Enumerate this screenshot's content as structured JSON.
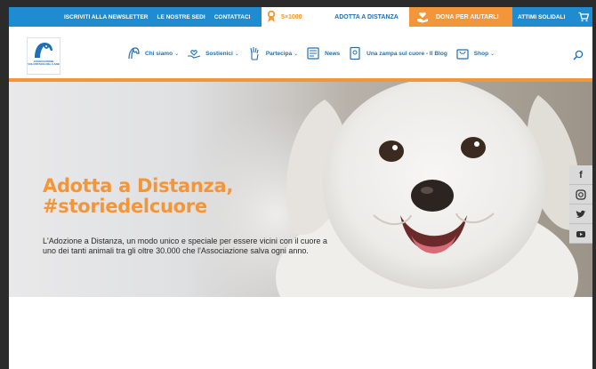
{
  "topbar": {
    "links": [
      "ISCRIVITI ALLA NEWSLETTER",
      "LE NOSTRE SEDI",
      "CONTATTACI"
    ],
    "five_per_mille": "5×1000",
    "adotta": "ADOTTA A DISTANZA",
    "dona": "DONA PER AIUTARLI",
    "attimi": "ATTIMI SOLIDALI",
    "cart_icon": "cart-icon"
  },
  "nav": {
    "logo_text": "ASSOCIAZIONE VOLONTARIA DEL CANE",
    "items": [
      {
        "label": "Chi siamo",
        "icon": "dog-head-icon",
        "dropdown": true
      },
      {
        "label": "Sostienici",
        "icon": "hands-heart-icon",
        "dropdown": true
      },
      {
        "label": "Partecipa",
        "icon": "raised-hand-icon",
        "dropdown": true
      },
      {
        "label": "News",
        "icon": "newspaper-icon",
        "dropdown": false
      },
      {
        "label": "Una zampa sul cuore - Il Blog",
        "icon": "book-icon",
        "dropdown": false
      },
      {
        "label": "Shop",
        "icon": "shop-bag-icon",
        "dropdown": true
      }
    ],
    "search_icon": "search-icon"
  },
  "hero": {
    "title_line1": "Adotta a Distanza,",
    "title_line2": "#storiedelcuore",
    "text": "L'Adozione a Distanza, un modo unico e speciale per essere vicini con il cuore a uno dei tanti animali tra gli oltre 30.000 che l'Associazione salva ogni anno."
  },
  "social": [
    {
      "name": "facebook-icon",
      "glyph": "f"
    },
    {
      "name": "instagram-icon",
      "glyph": "◎"
    },
    {
      "name": "twitter-icon",
      "glyph": "🐦"
    },
    {
      "name": "youtube-icon",
      "glyph": "▶"
    }
  ],
  "colors": {
    "brand_blue": "#1f8bd1",
    "orange": "#f3963a",
    "nav_blue": "#1f6fb5"
  }
}
